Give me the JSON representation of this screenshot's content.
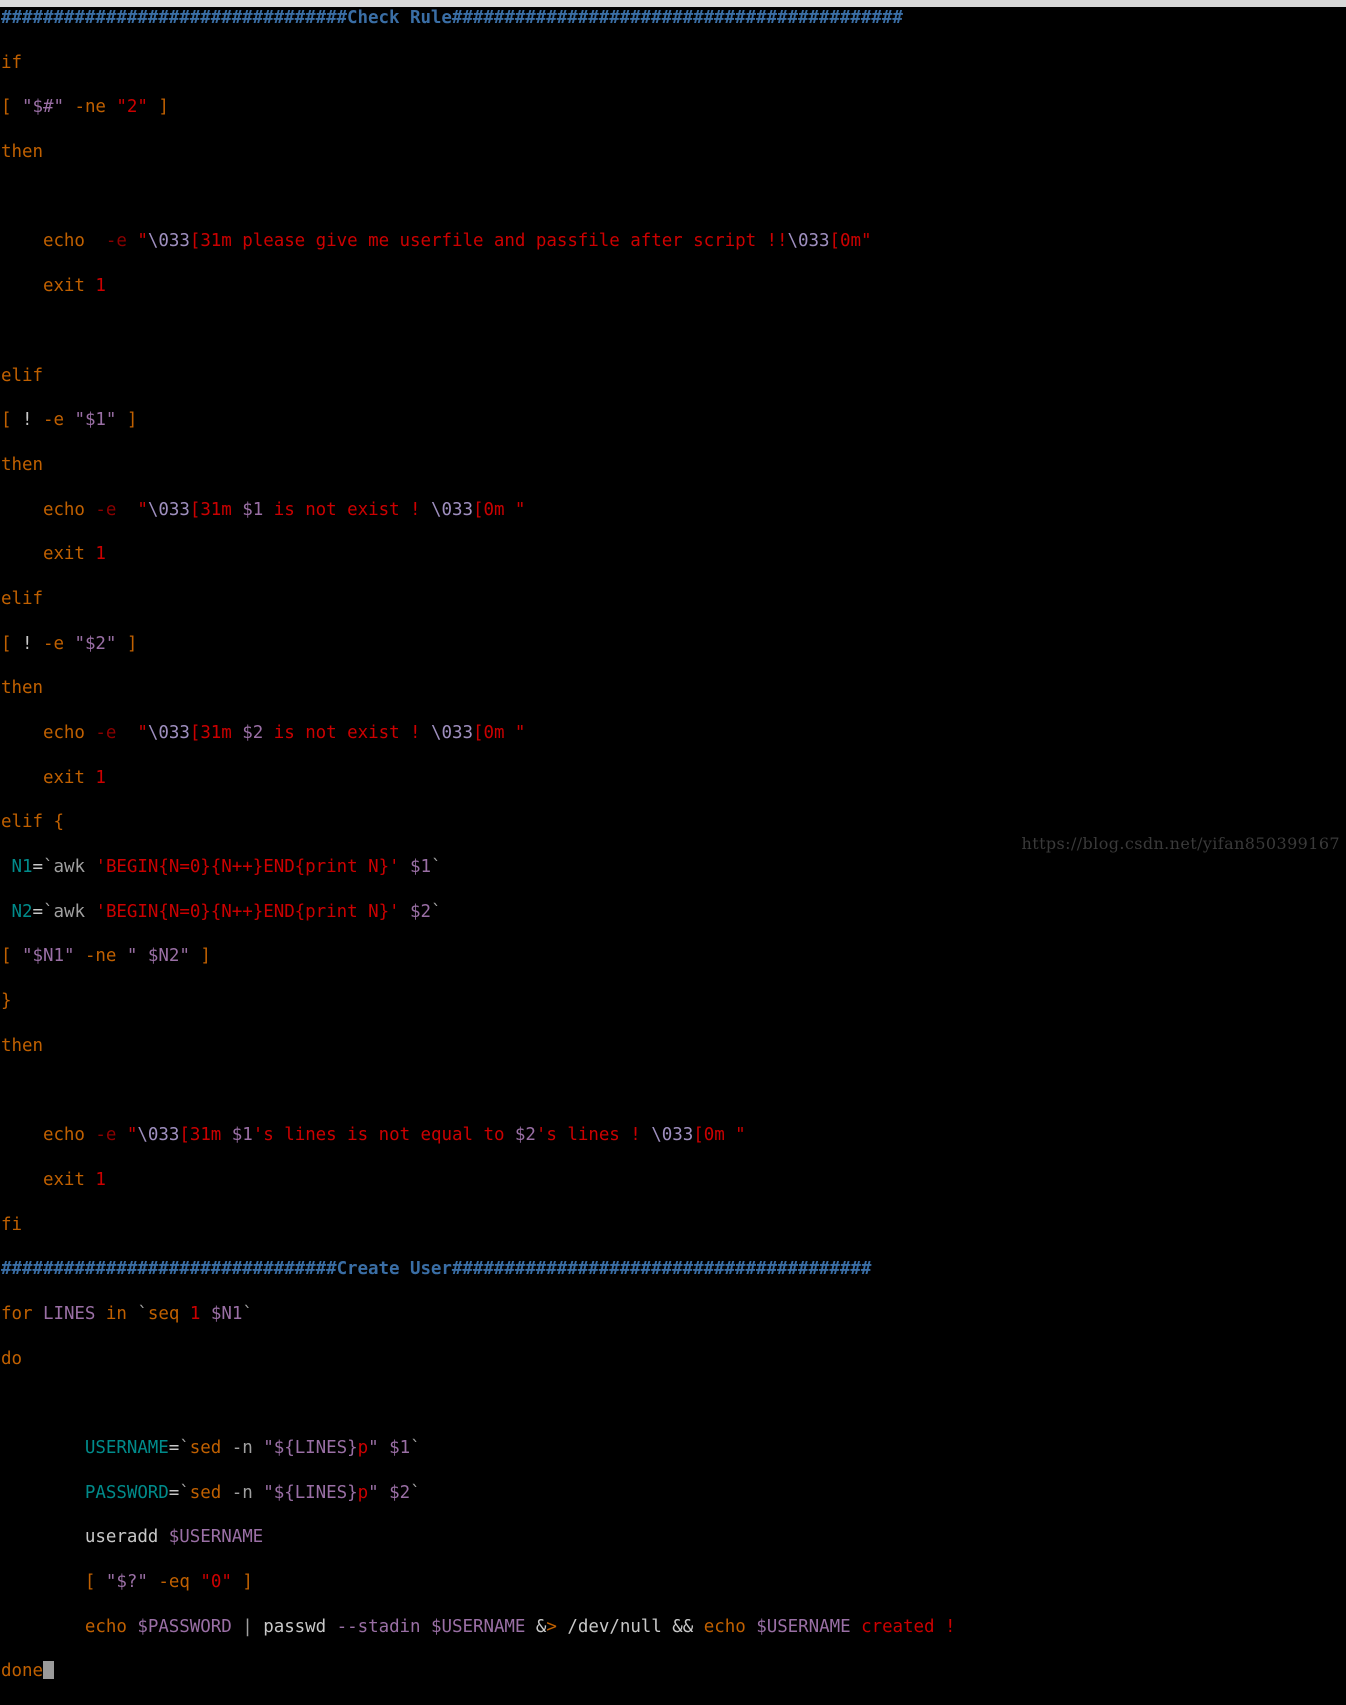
{
  "window": {
    "type": "terminal",
    "background_color": "#000000",
    "chrome_color": "#d8d8d8"
  },
  "editor": {
    "font_size_px": 17.5,
    "line_height_px": 22.35,
    "cursor_visible": true,
    "cursor_color": "#9a9a9a",
    "cursor_line_label": "done"
  },
  "palette": {
    "comment": "#3a6ea5",
    "keyword": "#c06000",
    "builtin": "#c06000",
    "option": "#8b0000",
    "string": "#cc0000",
    "number": "#cc0000",
    "variable": "#9a6fa5",
    "escape": "#9f8fbf",
    "assignment": "#008b8b",
    "plain": "#c8c8c8",
    "gray": "#a0a0a0",
    "background": "#000000"
  },
  "watermark": {
    "text": "https://blog.csdn.net/yifan850399167",
    "color": "#3a3a3a"
  },
  "script": {
    "language": "bash",
    "section_headers": [
      "Check Rule",
      "Create User"
    ],
    "lines": [
      {
        "n": 1,
        "tokens": [
          {
            "t": "#################################",
            "c": "cmt"
          },
          {
            "t": "Check Rule",
            "c": "cmt"
          },
          {
            "t": "###########################################",
            "c": "cmt"
          }
        ]
      },
      {
        "n": 2,
        "tokens": [
          {
            "t": "if",
            "c": "kw"
          }
        ]
      },
      {
        "n": 3,
        "tokens": [
          {
            "t": "[",
            "c": "brk"
          },
          {
            "t": " ",
            "c": "plain"
          },
          {
            "t": "\"$#\"",
            "c": "var"
          },
          {
            "t": " ",
            "c": "plain"
          },
          {
            "t": "-ne",
            "c": "kw"
          },
          {
            "t": " ",
            "c": "plain"
          },
          {
            "t": "\"",
            "c": "str"
          },
          {
            "t": "2",
            "c": "num"
          },
          {
            "t": "\"",
            "c": "str"
          },
          {
            "t": " ",
            "c": "plain"
          },
          {
            "t": "]",
            "c": "brk"
          }
        ]
      },
      {
        "n": 4,
        "tokens": [
          {
            "t": "then",
            "c": "kw"
          }
        ]
      },
      {
        "n": 5,
        "tokens": []
      },
      {
        "n": 6,
        "tokens": [
          {
            "t": "    ",
            "c": "plain"
          },
          {
            "t": "echo",
            "c": "blt"
          },
          {
            "t": "  ",
            "c": "plain"
          },
          {
            "t": "-e",
            "c": "opt"
          },
          {
            "t": " ",
            "c": "plain"
          },
          {
            "t": "\"",
            "c": "str"
          },
          {
            "t": "\\033",
            "c": "esc"
          },
          {
            "t": "[31m please give me userfile and passfile after script !!",
            "c": "str"
          },
          {
            "t": "\\033",
            "c": "esc"
          },
          {
            "t": "[0m\"",
            "c": "str"
          }
        ]
      },
      {
        "n": 7,
        "tokens": [
          {
            "t": "    ",
            "c": "plain"
          },
          {
            "t": "exit",
            "c": "blt"
          },
          {
            "t": " ",
            "c": "plain"
          },
          {
            "t": "1",
            "c": "num"
          }
        ]
      },
      {
        "n": 8,
        "tokens": []
      },
      {
        "n": 9,
        "tokens": [
          {
            "t": "elif",
            "c": "kw"
          }
        ]
      },
      {
        "n": 10,
        "tokens": [
          {
            "t": "[",
            "c": "brk"
          },
          {
            "t": " ! ",
            "c": "plain"
          },
          {
            "t": "-e",
            "c": "kw"
          },
          {
            "t": " ",
            "c": "plain"
          },
          {
            "t": "\"$1\"",
            "c": "var"
          },
          {
            "t": " ",
            "c": "plain"
          },
          {
            "t": "]",
            "c": "brk"
          }
        ]
      },
      {
        "n": 11,
        "tokens": [
          {
            "t": "then",
            "c": "kw"
          }
        ]
      },
      {
        "n": 12,
        "tokens": [
          {
            "t": "    ",
            "c": "plain"
          },
          {
            "t": "echo",
            "c": "blt"
          },
          {
            "t": " ",
            "c": "plain"
          },
          {
            "t": "-e",
            "c": "opt"
          },
          {
            "t": "  ",
            "c": "plain"
          },
          {
            "t": "\"",
            "c": "str"
          },
          {
            "t": "\\033",
            "c": "esc"
          },
          {
            "t": "[31m ",
            "c": "str"
          },
          {
            "t": "$1",
            "c": "var"
          },
          {
            "t": " is not exist ! ",
            "c": "str"
          },
          {
            "t": "\\033",
            "c": "esc"
          },
          {
            "t": "[0m \"",
            "c": "str"
          }
        ]
      },
      {
        "n": 13,
        "tokens": [
          {
            "t": "    ",
            "c": "plain"
          },
          {
            "t": "exit",
            "c": "blt"
          },
          {
            "t": " ",
            "c": "plain"
          },
          {
            "t": "1",
            "c": "num"
          }
        ]
      },
      {
        "n": 14,
        "tokens": [
          {
            "t": "elif",
            "c": "kw"
          }
        ]
      },
      {
        "n": 15,
        "tokens": [
          {
            "t": "[",
            "c": "brk"
          },
          {
            "t": " ! ",
            "c": "plain"
          },
          {
            "t": "-e",
            "c": "kw"
          },
          {
            "t": " ",
            "c": "plain"
          },
          {
            "t": "\"$2\"",
            "c": "var"
          },
          {
            "t": " ",
            "c": "plain"
          },
          {
            "t": "]",
            "c": "brk"
          }
        ]
      },
      {
        "n": 16,
        "tokens": [
          {
            "t": "then",
            "c": "kw"
          }
        ]
      },
      {
        "n": 17,
        "tokens": [
          {
            "t": "    ",
            "c": "plain"
          },
          {
            "t": "echo",
            "c": "blt"
          },
          {
            "t": " ",
            "c": "plain"
          },
          {
            "t": "-e",
            "c": "opt"
          },
          {
            "t": "  ",
            "c": "plain"
          },
          {
            "t": "\"",
            "c": "str"
          },
          {
            "t": "\\033",
            "c": "esc"
          },
          {
            "t": "[31m ",
            "c": "str"
          },
          {
            "t": "$2",
            "c": "var"
          },
          {
            "t": " is not exist ! ",
            "c": "str"
          },
          {
            "t": "\\033",
            "c": "esc"
          },
          {
            "t": "[0m \"",
            "c": "str"
          }
        ]
      },
      {
        "n": 18,
        "tokens": [
          {
            "t": "    ",
            "c": "plain"
          },
          {
            "t": "exit",
            "c": "blt"
          },
          {
            "t": " ",
            "c": "plain"
          },
          {
            "t": "1",
            "c": "num"
          }
        ]
      },
      {
        "n": 19,
        "tokens": [
          {
            "t": "elif",
            "c": "kw"
          },
          {
            "t": " ",
            "c": "plain"
          },
          {
            "t": "{",
            "c": "brk"
          }
        ]
      },
      {
        "n": 20,
        "tokens": [
          {
            "t": " ",
            "c": "plain"
          },
          {
            "t": "N1",
            "c": "asgn"
          },
          {
            "t": "=",
            "c": "plain"
          },
          {
            "t": "`",
            "c": "gray"
          },
          {
            "t": "awk",
            "c": "gray"
          },
          {
            "t": " ",
            "c": "plain"
          },
          {
            "t": "'BEGIN{N=0}{N++}END{print N}'",
            "c": "str"
          },
          {
            "t": " ",
            "c": "plain"
          },
          {
            "t": "$1",
            "c": "var"
          },
          {
            "t": "`",
            "c": "gray"
          }
        ]
      },
      {
        "n": 21,
        "tokens": [
          {
            "t": " ",
            "c": "plain"
          },
          {
            "t": "N2",
            "c": "asgn"
          },
          {
            "t": "=",
            "c": "plain"
          },
          {
            "t": "`",
            "c": "gray"
          },
          {
            "t": "awk",
            "c": "gray"
          },
          {
            "t": " ",
            "c": "plain"
          },
          {
            "t": "'BEGIN{N=0}{N++}END{print N}'",
            "c": "str"
          },
          {
            "t": " ",
            "c": "plain"
          },
          {
            "t": "$2",
            "c": "var"
          },
          {
            "t": "`",
            "c": "gray"
          }
        ]
      },
      {
        "n": 22,
        "tokens": [
          {
            "t": "[",
            "c": "brk"
          },
          {
            "t": " ",
            "c": "plain"
          },
          {
            "t": "\"$N1\"",
            "c": "var"
          },
          {
            "t": " ",
            "c": "plain"
          },
          {
            "t": "-ne",
            "c": "kw"
          },
          {
            "t": " ",
            "c": "plain"
          },
          {
            "t": "\" $N2\"",
            "c": "var"
          },
          {
            "t": " ",
            "c": "plain"
          },
          {
            "t": "]",
            "c": "brk"
          }
        ]
      },
      {
        "n": 23,
        "tokens": [
          {
            "t": "}",
            "c": "brk"
          }
        ]
      },
      {
        "n": 24,
        "tokens": [
          {
            "t": "then",
            "c": "kw"
          }
        ]
      },
      {
        "n": 25,
        "tokens": []
      },
      {
        "n": 26,
        "tokens": [
          {
            "t": "    ",
            "c": "plain"
          },
          {
            "t": "echo",
            "c": "blt"
          },
          {
            "t": " ",
            "c": "plain"
          },
          {
            "t": "-e",
            "c": "opt"
          },
          {
            "t": " ",
            "c": "plain"
          },
          {
            "t": "\"",
            "c": "str"
          },
          {
            "t": "\\033",
            "c": "esc"
          },
          {
            "t": "[31m ",
            "c": "str"
          },
          {
            "t": "$1",
            "c": "var"
          },
          {
            "t": "'s lines is not equal to ",
            "c": "str"
          },
          {
            "t": "$2",
            "c": "var"
          },
          {
            "t": "'s lines ! ",
            "c": "str"
          },
          {
            "t": "\\033",
            "c": "esc"
          },
          {
            "t": "[0m \"",
            "c": "str"
          }
        ]
      },
      {
        "n": 27,
        "tokens": [
          {
            "t": "    ",
            "c": "plain"
          },
          {
            "t": "exit",
            "c": "blt"
          },
          {
            "t": " ",
            "c": "plain"
          },
          {
            "t": "1",
            "c": "num"
          }
        ]
      },
      {
        "n": 28,
        "tokens": [
          {
            "t": "fi",
            "c": "kw"
          }
        ]
      },
      {
        "n": 29,
        "tokens": [
          {
            "t": "################################",
            "c": "cmt"
          },
          {
            "t": "Create User",
            "c": "cmt"
          },
          {
            "t": "########################################",
            "c": "cmt"
          }
        ]
      },
      {
        "n": 30,
        "tokens": [
          {
            "t": "for",
            "c": "kw"
          },
          {
            "t": " ",
            "c": "plain"
          },
          {
            "t": "LINES",
            "c": "var"
          },
          {
            "t": " ",
            "c": "plain"
          },
          {
            "t": "in",
            "c": "kw"
          },
          {
            "t": " ",
            "c": "plain"
          },
          {
            "t": "`",
            "c": "gray"
          },
          {
            "t": "seq",
            "c": "blt"
          },
          {
            "t": " ",
            "c": "plain"
          },
          {
            "t": "1",
            "c": "num"
          },
          {
            "t": " ",
            "c": "plain"
          },
          {
            "t": "$N1",
            "c": "var"
          },
          {
            "t": "`",
            "c": "gray"
          }
        ]
      },
      {
        "n": 31,
        "tokens": [
          {
            "t": "do",
            "c": "kw"
          }
        ]
      },
      {
        "n": 32,
        "tokens": []
      },
      {
        "n": 33,
        "tokens": [
          {
            "t": "        ",
            "c": "plain"
          },
          {
            "t": "USERNAME",
            "c": "asgn"
          },
          {
            "t": "=",
            "c": "plain"
          },
          {
            "t": "`",
            "c": "gray"
          },
          {
            "t": "sed",
            "c": "blt"
          },
          {
            "t": " ",
            "c": "plain"
          },
          {
            "t": "-n",
            "c": "gray"
          },
          {
            "t": " ",
            "c": "plain"
          },
          {
            "t": "\"${LINES}",
            "c": "var"
          },
          {
            "t": "p",
            "c": "str"
          },
          {
            "t": "\"",
            "c": "var"
          },
          {
            "t": " ",
            "c": "plain"
          },
          {
            "t": "$1",
            "c": "var"
          },
          {
            "t": "`",
            "c": "gray"
          }
        ]
      },
      {
        "n": 34,
        "tokens": [
          {
            "t": "        ",
            "c": "plain"
          },
          {
            "t": "PASSWORD",
            "c": "asgn"
          },
          {
            "t": "=",
            "c": "plain"
          },
          {
            "t": "`",
            "c": "gray"
          },
          {
            "t": "sed",
            "c": "blt"
          },
          {
            "t": " ",
            "c": "plain"
          },
          {
            "t": "-n",
            "c": "gray"
          },
          {
            "t": " ",
            "c": "plain"
          },
          {
            "t": "\"${LINES}",
            "c": "var"
          },
          {
            "t": "p",
            "c": "str"
          },
          {
            "t": "\"",
            "c": "var"
          },
          {
            "t": " ",
            "c": "plain"
          },
          {
            "t": "$2",
            "c": "var"
          },
          {
            "t": "`",
            "c": "gray"
          }
        ]
      },
      {
        "n": 35,
        "tokens": [
          {
            "t": "        ",
            "c": "plain"
          },
          {
            "t": "useradd",
            "c": "plain"
          },
          {
            "t": " ",
            "c": "plain"
          },
          {
            "t": "$USERNAME",
            "c": "var"
          }
        ]
      },
      {
        "n": 36,
        "tokens": [
          {
            "t": "        ",
            "c": "plain"
          },
          {
            "t": "[",
            "c": "brk"
          },
          {
            "t": " ",
            "c": "plain"
          },
          {
            "t": "\"$?\"",
            "c": "var"
          },
          {
            "t": " ",
            "c": "plain"
          },
          {
            "t": "-eq",
            "c": "kw"
          },
          {
            "t": " ",
            "c": "plain"
          },
          {
            "t": "\"",
            "c": "str"
          },
          {
            "t": "0",
            "c": "num"
          },
          {
            "t": "\"",
            "c": "str"
          },
          {
            "t": " ",
            "c": "plain"
          },
          {
            "t": "]",
            "c": "brk"
          }
        ]
      },
      {
        "n": 37,
        "tokens": [
          {
            "t": "        ",
            "c": "plain"
          },
          {
            "t": "echo",
            "c": "blt"
          },
          {
            "t": " ",
            "c": "plain"
          },
          {
            "t": "$PASSWORD",
            "c": "var"
          },
          {
            "t": " ",
            "c": "plain"
          },
          {
            "t": "|",
            "c": "gray"
          },
          {
            "t": " ",
            "c": "plain"
          },
          {
            "t": "passwd",
            "c": "plain"
          },
          {
            "t": " ",
            "c": "plain"
          },
          {
            "t": "--stadin",
            "c": "var"
          },
          {
            "t": " ",
            "c": "plain"
          },
          {
            "t": "$USERNAME",
            "c": "var"
          },
          {
            "t": " ",
            "c": "plain"
          },
          {
            "t": "&",
            "c": "plain"
          },
          {
            "t": ">",
            "c": "kw"
          },
          {
            "t": " ",
            "c": "plain"
          },
          {
            "t": "/dev/null",
            "c": "plain"
          },
          {
            "t": " ",
            "c": "plain"
          },
          {
            "t": "&&",
            "c": "plain"
          },
          {
            "t": " ",
            "c": "plain"
          },
          {
            "t": "echo",
            "c": "blt"
          },
          {
            "t": " ",
            "c": "plain"
          },
          {
            "t": "$USERNAME",
            "c": "var"
          },
          {
            "t": " ",
            "c": "plain"
          },
          {
            "t": "created !",
            "c": "str"
          }
        ]
      },
      {
        "n": 38,
        "tokens": [
          {
            "t": "done",
            "c": "kw"
          },
          {
            "t": "__CURSOR__",
            "c": "cursor"
          }
        ]
      }
    ]
  }
}
